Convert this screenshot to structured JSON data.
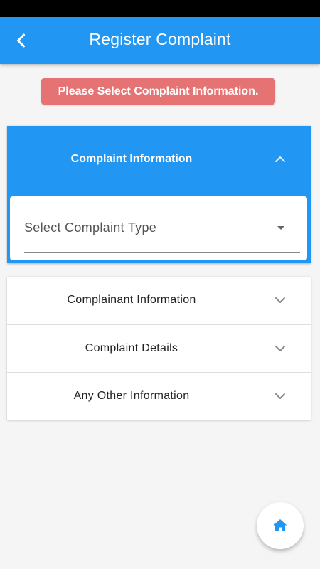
{
  "app_bar": {
    "title": "Register Complaint",
    "back_icon": "chevron-left-icon"
  },
  "warning": {
    "message": "Please Select Complaint Information."
  },
  "sections": {
    "complaint_information": {
      "label": "Complaint Information",
      "expanded": true,
      "select_placeholder": "Select Complaint Type"
    },
    "collapsed": [
      {
        "label": "Complainant Information"
      },
      {
        "label": "Complaint Details"
      },
      {
        "label": "Any Other Information"
      }
    ]
  },
  "fab": {
    "icon": "home-icon"
  },
  "colors": {
    "primary": "#2196f3",
    "warning": "#e57373",
    "background": "#f5f5f5"
  }
}
